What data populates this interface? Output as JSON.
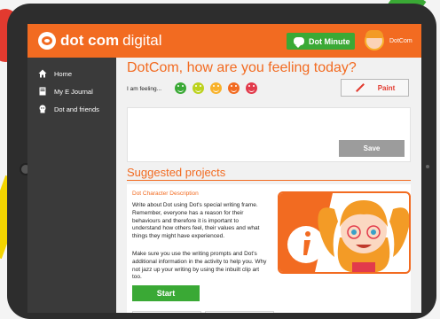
{
  "app": {
    "brand_dot": "dot com",
    "brand_digital": "digital",
    "dot_minute_label": "Dot Minute",
    "profile_name": "DotCom"
  },
  "sidebar": {
    "items": [
      {
        "label": "Home",
        "icon": "home-icon"
      },
      {
        "label": "My E Journal",
        "icon": "journal-icon"
      },
      {
        "label": "Dot and friends",
        "icon": "friends-icon"
      }
    ]
  },
  "feeling": {
    "heading": "DotCom, how are you feeling today?",
    "label": "I am feeling...",
    "moods": [
      {
        "name": "very-happy",
        "color": "#3aa935"
      },
      {
        "name": "happy",
        "color": "#bcd21d"
      },
      {
        "name": "neutral",
        "color": "#f8b22c"
      },
      {
        "name": "sad",
        "color": "#f26b21"
      },
      {
        "name": "angry",
        "color": "#e23a4b"
      }
    ],
    "paint_label": "Paint",
    "save_label": "Save"
  },
  "projects": {
    "heading": "Suggested projects",
    "card": {
      "title": "Dot Character Description",
      "paragraph1": "Write about Dot using Dot's special writing frame. Remember, everyone has a reason for their behaviours and therefore it is important to understand how others feel, their values and what things they might have experienced.",
      "paragraph2": "Make sure you use the writing prompts and Dot's additional information in the activity to help you. Why not jazz up your writing by using the inbuilt clip art too.",
      "start_label": "Start",
      "info_icon": "info-icon"
    }
  },
  "colors": {
    "brand_orange": "#f26b21",
    "sidebar": "#3a3a3a",
    "green": "#3aa935",
    "save_gray": "#9c9c9c"
  }
}
